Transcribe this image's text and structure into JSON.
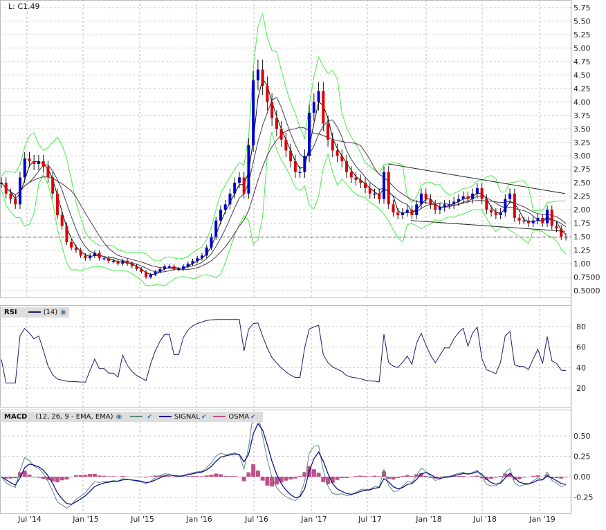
{
  "header": {
    "last_label": "L: C1.49"
  },
  "rsi_legend": {
    "name": "RSI",
    "params": "(14)"
  },
  "macd_legend": {
    "name": "MACD",
    "params": "(12, 26, 9 - EMA, EMA)",
    "signal": "SIGNAL",
    "osma": "OSMA"
  },
  "colors": {
    "up": "#0000cc",
    "down": "#dd0000",
    "band": "#44ee44",
    "ma_fast": "#111111",
    "ma_mid": "#334455",
    "ma_slow": "#603050",
    "rsi": "#1a1a6e",
    "macd": "#5a8a80",
    "signal": "#10108a",
    "osma": "#c0508a"
  },
  "chart_data": [
    {
      "type": "candlestick",
      "title": "Price",
      "ylim": [
        0.5,
        5.75
      ],
      "yticks": [
        "5.75",
        "5.50",
        "5.25",
        "5.00",
        "4.75",
        "4.50",
        "4.25",
        "4.00",
        "3.75",
        "3.50",
        "3.25",
        "3.00",
        "2.75",
        "2.50",
        "2.25",
        "2.00",
        "1.75",
        "1.50",
        "1.25",
        "1.00",
        "0.7500",
        "0.5000"
      ],
      "xticks": [
        "Jul '14",
        "Jan '15",
        "Jul '15",
        "Jan '16",
        "Jul '16",
        "Jan '17",
        "Jul '17",
        "Jan '18",
        "Jul '18",
        "Jan '19"
      ],
      "last_close": 1.49,
      "close": [
        2.5,
        2.3,
        2.2,
        2.1,
        2.6,
        2.95,
        2.9,
        2.85,
        2.9,
        2.8,
        2.6,
        2.3,
        1.9,
        1.7,
        1.4,
        1.3,
        1.25,
        1.15,
        1.1,
        1.15,
        1.2,
        1.1,
        1.1,
        1.05,
        1.05,
        1.0,
        1.05,
        1.0,
        0.95,
        0.9,
        0.85,
        0.75,
        0.8,
        0.85,
        0.9,
        0.95,
        0.95,
        0.9,
        0.9,
        0.95,
        1.0,
        1.05,
        1.1,
        1.15,
        1.3,
        1.5,
        1.8,
        2.0,
        2.1,
        2.3,
        2.5,
        2.6,
        2.3,
        3.2,
        4.4,
        4.6,
        4.3,
        4.0,
        3.7,
        3.5,
        3.3,
        3.1,
        2.9,
        2.7,
        2.7,
        3.0,
        3.8,
        4.0,
        4.2,
        3.6,
        3.3,
        3.1,
        3.0,
        2.9,
        2.7,
        2.6,
        2.55,
        2.5,
        2.4,
        2.3,
        2.3,
        2.2,
        2.7,
        2.1,
        1.95,
        1.9,
        1.95,
        2.0,
        1.9,
        2.1,
        2.3,
        2.2,
        2.1,
        2.0,
        2.05,
        2.1,
        2.1,
        2.15,
        2.2,
        2.25,
        2.2,
        2.3,
        2.4,
        2.2,
        2.0,
        1.95,
        1.9,
        1.95,
        2.2,
        2.3,
        1.85,
        1.8,
        1.8,
        1.75,
        1.8,
        1.85,
        1.75,
        2.0,
        1.7,
        1.65,
        1.5,
        1.49
      ],
      "trendlines": [
        {
          "from": [
            0.68,
            2.85
          ],
          "to": [
            0.99,
            2.3
          ]
        },
        {
          "from": [
            0.72,
            1.8
          ],
          "to": [
            0.99,
            1.6
          ]
        }
      ]
    },
    {
      "type": "line",
      "title": "RSI (14)",
      "ylim": [
        10,
        95
      ],
      "yticks": [
        "80",
        "60",
        "40",
        "20"
      ]
    },
    {
      "type": "bar+line",
      "title": "MACD (12, 26, 9 - EMA, EMA)",
      "ylim": [
        -0.38,
        0.75
      ],
      "yticks": [
        "0.50",
        "0.25",
        "0.00",
        "-0.25"
      ]
    }
  ]
}
